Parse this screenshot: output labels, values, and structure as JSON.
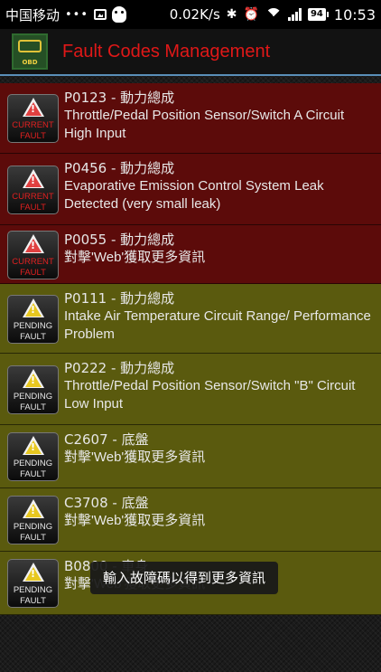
{
  "status_bar": {
    "carrier": "中国移动",
    "dots": "•••",
    "speed": "0.02K/s",
    "battery": "94",
    "time": "10:53"
  },
  "app": {
    "logo_text": "OBD",
    "title": "Fault Codes Management"
  },
  "faults": [
    {
      "type": "current",
      "badge_line1": "CURRENT",
      "badge_line2": "FAULT",
      "code": "P0123 - 動力總成",
      "description": "Throttle/Pedal Position Sensor/Switch A Circuit High Input"
    },
    {
      "type": "current",
      "badge_line1": "CURRENT",
      "badge_line2": "FAULT",
      "code": "P0456 - 動力總成",
      "description": "Evaporative Emission Control System Leak Detected (very small leak)"
    },
    {
      "type": "current",
      "badge_line1": "CURRENT",
      "badge_line2": "FAULT",
      "code": "P0055 - 動力總成",
      "description": "對擊'Web'獲取更多資訊"
    },
    {
      "type": "pending",
      "badge_line1": "PENDING",
      "badge_line2": "FAULT",
      "code": "P0111 - 動力總成",
      "description": "Intake Air Temperature Circuit Range/ Performance Problem"
    },
    {
      "type": "pending",
      "badge_line1": "PENDING",
      "badge_line2": "FAULT",
      "code": "P0222 - 動力總成",
      "description": "Throttle/Pedal Position Sensor/Switch \"B\" Circuit Low Input"
    },
    {
      "type": "pending",
      "badge_line1": "PENDING",
      "badge_line2": "FAULT",
      "code": "C2607 - 底盤",
      "description": "對擊'Web'獲取更多資訊"
    },
    {
      "type": "pending",
      "badge_line1": "PENDING",
      "badge_line2": "FAULT",
      "code": "C3708 - 底盤",
      "description": "對擊'Web'獲取更多資訊"
    },
    {
      "type": "pending",
      "badge_line1": "PENDING",
      "badge_line2": "FAULT",
      "code": "B0800 - 車身",
      "description": "對擊'Web'獲取更多資訊"
    }
  ],
  "toast": "輸入故障碼以得到更多資訊",
  "colors": {
    "current_bg": "#5c0b0a",
    "pending_bg": "#5a5a0e",
    "title_red": "#e01818",
    "accent_line": "#5a8fb8"
  }
}
